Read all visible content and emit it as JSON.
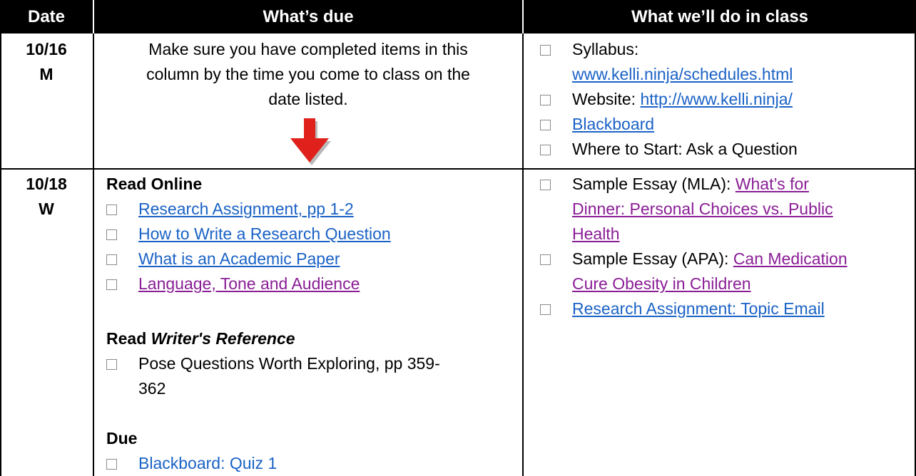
{
  "headers": {
    "date": "Date",
    "due": "What’s due",
    "class": "What we’ll do in class"
  },
  "rows": [
    {
      "date": "10/16",
      "day": "M",
      "due_note": [
        "Make sure you have completed items in this",
        "column by the time you come to class on the",
        "date listed."
      ],
      "class_items": {
        "syllabus_label": "Syllabus:",
        "syllabus_link": "www.kelli.ninja/schedules.html",
        "website_label": "Website: ",
        "website_link": "http://www.kelli.ninja/",
        "blackboard": "Blackboard",
        "where_to_start": "Where to Start: Ask a Question"
      }
    },
    {
      "date": "10/18",
      "day": "W",
      "read_online_heading": "Read Online",
      "read_online_items": [
        "Research Assignment, pp 1-2",
        "How to Write a Research Question",
        "What is an Academic Paper",
        "Language, Tone and Audience"
      ],
      "read_ref_heading_prefix": "Read ",
      "read_ref_heading_italic": "Writer's Reference",
      "read_ref_item": [
        "Pose Questions Worth Exploring, pp 359-",
        "362"
      ],
      "due_heading": "Due",
      "due_item": "Blackboard: Quiz 1",
      "class_items": {
        "essay_mla_label": "Sample Essay (MLA): ",
        "essay_mla_link": [
          "What’s for",
          "Dinner: Personal Choices vs. Public",
          "Health"
        ],
        "essay_apa_label": "Sample Essay (APA): ",
        "essay_apa_link": [
          "Can Medication",
          "Cure Obesity in Children"
        ],
        "topic_email": "Research Assignment: Topic Email"
      }
    }
  ],
  "colors": {
    "header_bg": "#000000",
    "link": "#1a62c6",
    "visited_link": "#8a1d96",
    "arrow": "#e0201a"
  },
  "icons": {
    "checkbox": "empty-checkbox-icon",
    "arrow": "red-down-arrow-icon"
  }
}
